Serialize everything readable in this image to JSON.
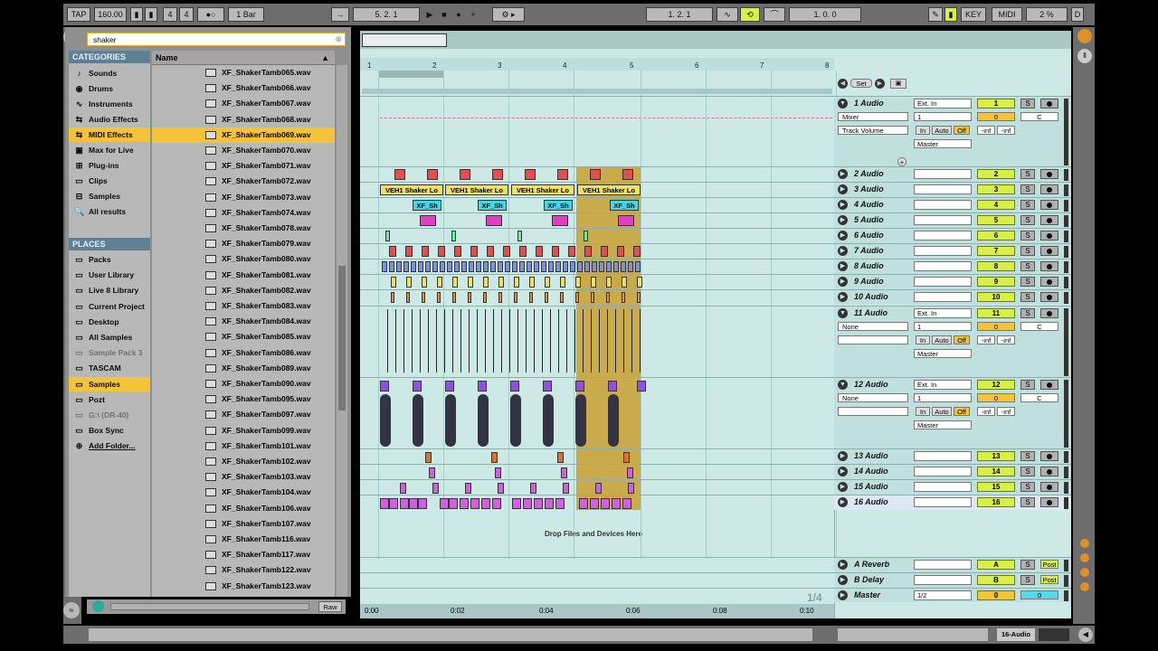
{
  "transport": {
    "tap": "TAP",
    "tempo": "160.00",
    "sig_num": "4",
    "sig_den": "4",
    "quant": "1 Bar",
    "position": "5.   2.   1",
    "loop_start": "1.   2.   1",
    "loop_len": "1.   0.   0",
    "key": "KEY",
    "midi": "MIDI",
    "cpu": "2 %",
    "d": "D"
  },
  "browser": {
    "search_value": "shaker",
    "categories_header": "CATEGORIES",
    "name_header": "Name",
    "places_header": "PLACES",
    "categories": [
      {
        "label": "Sounds",
        "icon": "note-icon"
      },
      {
        "label": "Drums",
        "icon": "drum-icon"
      },
      {
        "label": "Instruments",
        "icon": "instrument-icon"
      },
      {
        "label": "Audio Effects",
        "icon": "audio-fx-icon"
      },
      {
        "label": "MIDI Effects",
        "icon": "midi-fx-icon"
      },
      {
        "label": "Max for Live",
        "icon": "max-icon"
      },
      {
        "label": "Plug-ins",
        "icon": "plugin-icon"
      },
      {
        "label": "Clips",
        "icon": "clip-icon"
      },
      {
        "label": "Samples",
        "icon": "sample-icon"
      },
      {
        "label": "All results",
        "icon": "search-icon"
      }
    ],
    "places": [
      {
        "label": "Packs"
      },
      {
        "label": "User Library"
      },
      {
        "label": "Live 8 Library"
      },
      {
        "label": "Current Project"
      },
      {
        "label": "Desktop"
      },
      {
        "label": "All Samples"
      },
      {
        "label": "Sample Pack 3"
      },
      {
        "label": "TASCAM"
      },
      {
        "label": "Samples"
      },
      {
        "label": "Pozt"
      },
      {
        "label": "G:\\ (DR-40)"
      },
      {
        "label": "Box Sync"
      },
      {
        "label": "Add Folder..."
      }
    ],
    "files": [
      "XF_ShakerTamb065.wav",
      "XF_ShakerTamb066.wav",
      "XF_ShakerTamb067.wav",
      "XF_ShakerTamb068.wav",
      "XF_ShakerTamb069.wav",
      "XF_ShakerTamb070.wav",
      "XF_ShakerTamb071.wav",
      "XF_ShakerTamb072.wav",
      "XF_ShakerTamb073.wav",
      "XF_ShakerTamb074.wav",
      "XF_ShakerTamb078.wav",
      "XF_ShakerTamb079.wav",
      "XF_ShakerTamb080.wav",
      "XF_ShakerTamb081.wav",
      "XF_ShakerTamb082.wav",
      "XF_ShakerTamb083.wav",
      "XF_ShakerTamb084.wav",
      "XF_ShakerTamb085.wav",
      "XF_ShakerTamb086.wav",
      "XF_ShakerTamb089.wav",
      "XF_ShakerTamb090.wav",
      "XF_ShakerTamb095.wav",
      "XF_ShakerTamb097.wav",
      "XF_ShakerTamb099.wav",
      "XF_ShakerTamb101.wav",
      "XF_ShakerTamb102.wav",
      "XF_ShakerTamb103.wav",
      "XF_ShakerTamb104.wav",
      "XF_ShakerTamb106.wav",
      "XF_ShakerTamb107.wav",
      "XF_ShakerTamb116.wav",
      "XF_ShakerTamb117.wav",
      "XF_ShakerTamb122.wav",
      "XF_ShakerTamb123.wav"
    ],
    "raw": "Raw"
  },
  "arrangement": {
    "bars": [
      "1",
      "2",
      "3",
      "4",
      "5",
      "6",
      "7",
      "8"
    ],
    "times": [
      "0:00",
      "0:02",
      "0:04",
      "0:06",
      "0:08",
      "0:10"
    ],
    "drop_text": "Drop Files and Devices Here",
    "set_label": "Set",
    "zoom": "1/4",
    "clip_vehi": "VEH1 Shaker Lo",
    "clip_xf": "XF_Sh"
  },
  "tracks": {
    "t1": {
      "name": "1 Audio",
      "num": "1",
      "in": "Ext. In",
      "ch": "1",
      "mixer": "Mixer",
      "auto": "Track Volume",
      "out": "Master",
      "vol": "0",
      "pan": "C"
    },
    "t2": {
      "name": "2 Audio",
      "num": "2"
    },
    "t3": {
      "name": "3 Audio",
      "num": "3"
    },
    "t4": {
      "name": "4 Audio",
      "num": "4"
    },
    "t5": {
      "name": "5 Audio",
      "num": "5"
    },
    "t6": {
      "name": "6 Audio",
      "num": "6"
    },
    "t7": {
      "name": "7 Audio",
      "num": "7"
    },
    "t8": {
      "name": "8 Audio",
      "num": "8"
    },
    "t9": {
      "name": "9 Audio",
      "num": "9"
    },
    "t10": {
      "name": "10 Audio",
      "num": "10"
    },
    "t11": {
      "name": "11 Audio",
      "num": "11",
      "in": "Ext. In",
      "ch": "1",
      "none": "None",
      "out": "Master",
      "vol": "0",
      "pan": "C"
    },
    "t12": {
      "name": "12 Audio",
      "num": "12",
      "in": "Ext. In",
      "ch": "1",
      "none": "None",
      "out": "Master",
      "vol": "0",
      "pan": "C"
    },
    "t13": {
      "name": "13 Audio",
      "num": "13"
    },
    "t14": {
      "name": "14 Audio",
      "num": "14"
    },
    "t15": {
      "name": "15 Audio",
      "num": "15"
    },
    "t16": {
      "name": "16 Audio",
      "num": "16"
    },
    "ra": {
      "name": "A Reverb",
      "num": "A",
      "post": "Post"
    },
    "rb": {
      "name": "B Delay",
      "num": "B",
      "post": "Post"
    },
    "master": {
      "name": "Master",
      "num": "0",
      "out": "1/2",
      "vol": "0"
    }
  },
  "monitor": {
    "in": "In",
    "auto": "Auto",
    "off": "Off",
    "inf": "-inf",
    "s": "S"
  },
  "status": {
    "track": "16-Audio"
  },
  "colors": {
    "accent": "#f3c33a",
    "num": "#d7ef46",
    "arr_bg": "#cce9e6",
    "gold": "#c8a030"
  }
}
